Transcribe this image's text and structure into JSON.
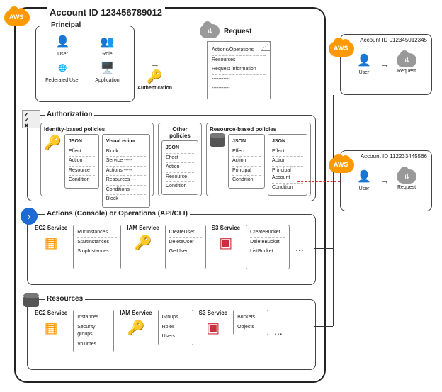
{
  "main_account": {
    "title": "Account ID 123456789012",
    "principal": {
      "label": "Principal",
      "items": [
        "User",
        "Role",
        "Federated User",
        "Application"
      ],
      "auth_label": "Authentication"
    },
    "request": {
      "label": "Request",
      "fields": [
        "Actions/Operations",
        "Resources",
        "Request information",
        "-----------",
        "-----------"
      ]
    },
    "authorization": {
      "label": "Authorization",
      "identity": {
        "label": "Identity-based policies",
        "json_label": "JSON",
        "json_fields": [
          "Effect",
          "Action",
          "Resource",
          "Condition"
        ],
        "visual_label": "Visual editor",
        "visual_fields": [
          "Block",
          "Service -----",
          "Actions -----",
          "Resources ---",
          "Conditions ---",
          "Block",
          "-----"
        ]
      },
      "other": {
        "label": "Other policies",
        "json_label": "JSON",
        "fields": [
          "Effect",
          "Action",
          "Resource",
          "Condition"
        ]
      },
      "resource": {
        "label": "Resource-based policies",
        "json1_label": "JSON",
        "json1_fields": [
          "Effect",
          "Action",
          "Principal",
          "Condition"
        ],
        "json2_label": "JSON",
        "json2_fields": [
          "Effect",
          "Action",
          "Principal Account",
          "Condition"
        ]
      }
    },
    "actions": {
      "label": "Actions (Console) or Operations (API/CLI)",
      "ec2_label": "EC2 Service",
      "ec2_ops": [
        "RunInstances",
        "StartInstances",
        "StopInstances",
        "..."
      ],
      "iam_label": "IAM Service",
      "iam_ops": [
        "CreateUser",
        "DeleteUser",
        "GetUser",
        "..."
      ],
      "s3_label": "S3 Service",
      "s3_ops": [
        "CreateBucket",
        "DeleteBucket",
        "ListBucket",
        "..."
      ],
      "more": "..."
    },
    "resources": {
      "label": "Resources",
      "ec2_label": "EC2 Service",
      "ec2_res": [
        "Instances",
        "Security groups",
        "Volumes"
      ],
      "iam_label": "IAM Service",
      "iam_res": [
        "Groups",
        "Roles",
        "Users"
      ],
      "s3_label": "S3 Service",
      "s3_res": [
        "Buckets",
        "Objects"
      ],
      "more": "..."
    }
  },
  "ext_accounts": [
    {
      "title": "Account ID 012345012345",
      "user_label": "User",
      "request_label": "Request"
    },
    {
      "title": "Account ID 112233445566",
      "user_label": "User",
      "request_label": "Request"
    }
  ]
}
